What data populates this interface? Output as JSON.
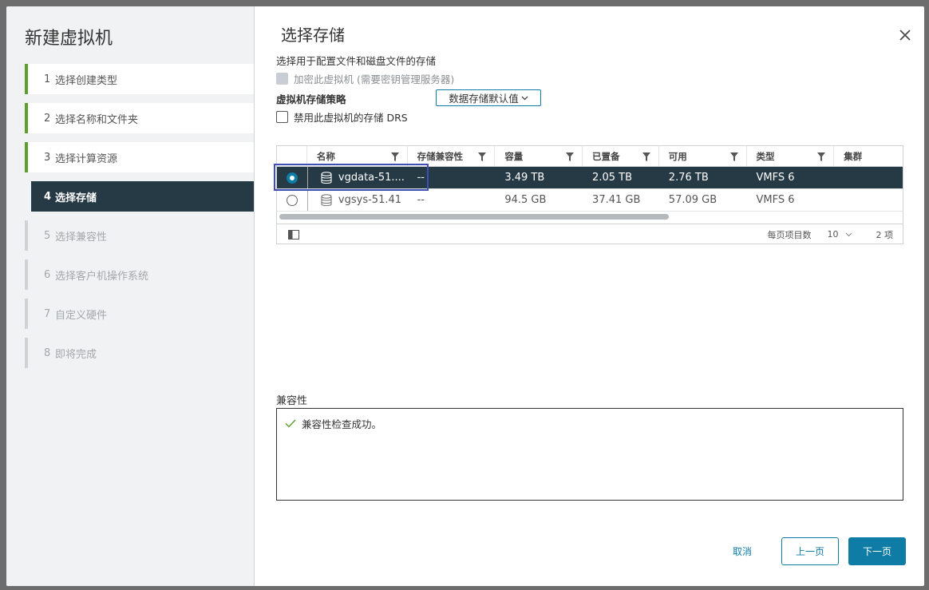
{
  "sidebar": {
    "title": "新建虚拟机",
    "steps": [
      {
        "num": "1",
        "label": "选择创建类型",
        "state": "done"
      },
      {
        "num": "2",
        "label": "选择名称和文件夹",
        "state": "done"
      },
      {
        "num": "3",
        "label": "选择计算资源",
        "state": "done"
      },
      {
        "num": "4",
        "label": "选择存储",
        "state": "active"
      },
      {
        "num": "5",
        "label": "选择兼容性",
        "state": "future"
      },
      {
        "num": "6",
        "label": "选择客户机操作系统",
        "state": "future"
      },
      {
        "num": "7",
        "label": "自定义硬件",
        "state": "future"
      },
      {
        "num": "8",
        "label": "即将完成",
        "state": "future"
      }
    ]
  },
  "main": {
    "title": "选择存储",
    "subtitle": "选择用于配置文件和磁盘文件的存储",
    "encrypt_label": "加密此虚拟机 (需要密钥管理服务器)",
    "policy_label": "虚拟机存储策略",
    "policy_value": "数据存储默认值",
    "drs_label": "禁用此虚拟机的存储 DRS"
  },
  "grid": {
    "columns": [
      "名称",
      "存储兼容性",
      "容量",
      "已置备",
      "可用",
      "类型",
      "集群"
    ],
    "rows": [
      {
        "name": "vgdata-51....",
        "compat": "--",
        "capacity": "3.49 TB",
        "provisioned": "2.05 TB",
        "free": "2.76 TB",
        "type": "VMFS 6",
        "cluster": "",
        "selected": true
      },
      {
        "name": "vgsys-51.41",
        "compat": "--",
        "capacity": "94.5 GB",
        "provisioned": "37.41 GB",
        "free": "57.09 GB",
        "type": "VMFS 6",
        "cluster": "",
        "selected": false
      }
    ],
    "footer": {
      "per_page_label": "每页项目数",
      "per_page_value": "10",
      "count": "2 项"
    }
  },
  "compat": {
    "title": "兼容性",
    "message": "兼容性检查成功。"
  },
  "buttons": {
    "cancel": "取消",
    "prev": "上一页",
    "next": "下一页"
  },
  "colors": {
    "accent": "#0f7ca6",
    "active_row": "#253a45",
    "done_bar": "#5d9e2c"
  }
}
